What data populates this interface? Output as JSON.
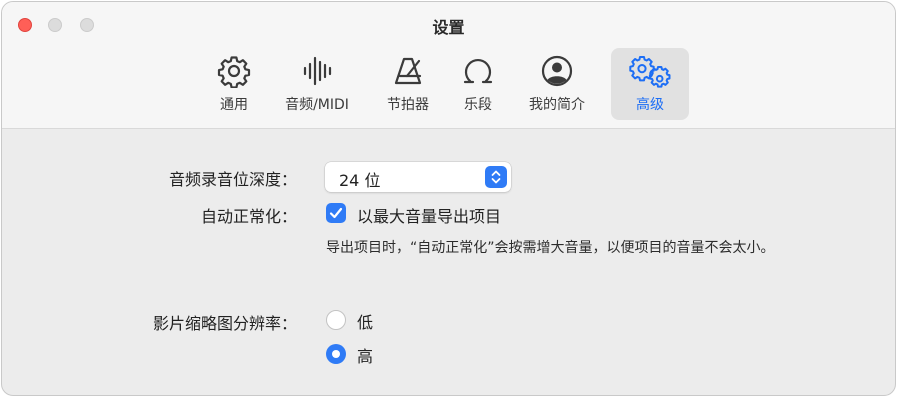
{
  "window": {
    "title": "设置"
  },
  "tabs": [
    {
      "label": "通用",
      "icon": "gear-icon",
      "active": false
    },
    {
      "label": "音频/MIDI",
      "icon": "waveform-icon",
      "active": false
    },
    {
      "label": "节拍器",
      "icon": "metronome-icon",
      "active": false
    },
    {
      "label": "乐段",
      "icon": "loop-icon",
      "active": false
    },
    {
      "label": "我的简介",
      "icon": "person-circle-icon",
      "active": false
    },
    {
      "label": "高级",
      "icon": "gears-icon",
      "active": true
    }
  ],
  "settings": {
    "bit_depth": {
      "label": "音频录音位深度：",
      "value": "24 位"
    },
    "auto_normalize": {
      "label": "自动正常化：",
      "checkbox_label": "以最大音量导出项目",
      "checked": true,
      "description": "导出项目时，“自动正常化”会按需增大音量，以便项目的音量不会太小。"
    },
    "thumbnail_resolution": {
      "label": "影片缩略图分辨率：",
      "options": [
        {
          "label": "低",
          "selected": false
        },
        {
          "label": "高",
          "selected": true
        }
      ]
    }
  },
  "colors": {
    "accent": "#2f7bf6",
    "close_button": "#ff5f57"
  }
}
